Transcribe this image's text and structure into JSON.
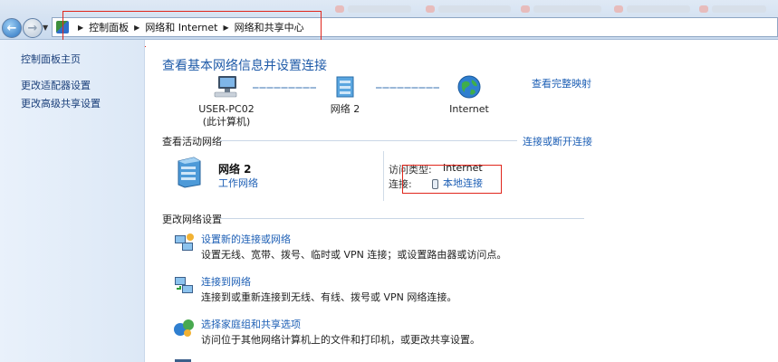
{
  "window": {
    "breadcrumb": [
      "控制面板",
      "网络和 Internet",
      "网络和共享中心"
    ]
  },
  "sidebar": {
    "items": [
      {
        "label": "控制面板主页"
      },
      {
        "label": "更改适配器设置"
      },
      {
        "label": "更改高级共享设置"
      }
    ]
  },
  "main": {
    "title": "查看基本网络信息并设置连接",
    "full_map_link": "查看完整映射",
    "map": {
      "computer": {
        "name": "USER-PC02",
        "sub": "(此计算机)",
        "icon": "computer-icon"
      },
      "network": {
        "name": "网络  2",
        "icon": "network-icon"
      },
      "internet": {
        "name": "Internet",
        "icon": "globe-icon"
      }
    },
    "active_networks": {
      "header": "查看活动网络",
      "connect_link": "连接或断开连接",
      "network_name": "网络  2",
      "network_type": "工作网络",
      "access_type_label": "访问类型:",
      "access_type_value": "Internet",
      "connections_label": "连接:",
      "connections_value": "本地连接"
    },
    "change_settings": {
      "header": "更改网络设置",
      "tasks": [
        {
          "title": "设置新的连接或网络",
          "desc": "设置无线、宽带、拨号、临时或 VPN 连接；或设置路由器或访问点。",
          "icon": "new-connection-icon"
        },
        {
          "title": "连接到网络",
          "desc": "连接到或重新连接到无线、有线、拨号或 VPN 网络连接。",
          "icon": "connect-network-icon"
        },
        {
          "title": "选择家庭组和共享选项",
          "desc": "访问位于其他网络计算机上的文件和打印机，或更改共享设置。",
          "icon": "homegroup-icon"
        }
      ]
    }
  },
  "colors": {
    "link": "#1d5fb5",
    "title": "#1e5aa8",
    "highlight_box": "#e0261c",
    "sidebar_bg": "#e2ecf8"
  }
}
